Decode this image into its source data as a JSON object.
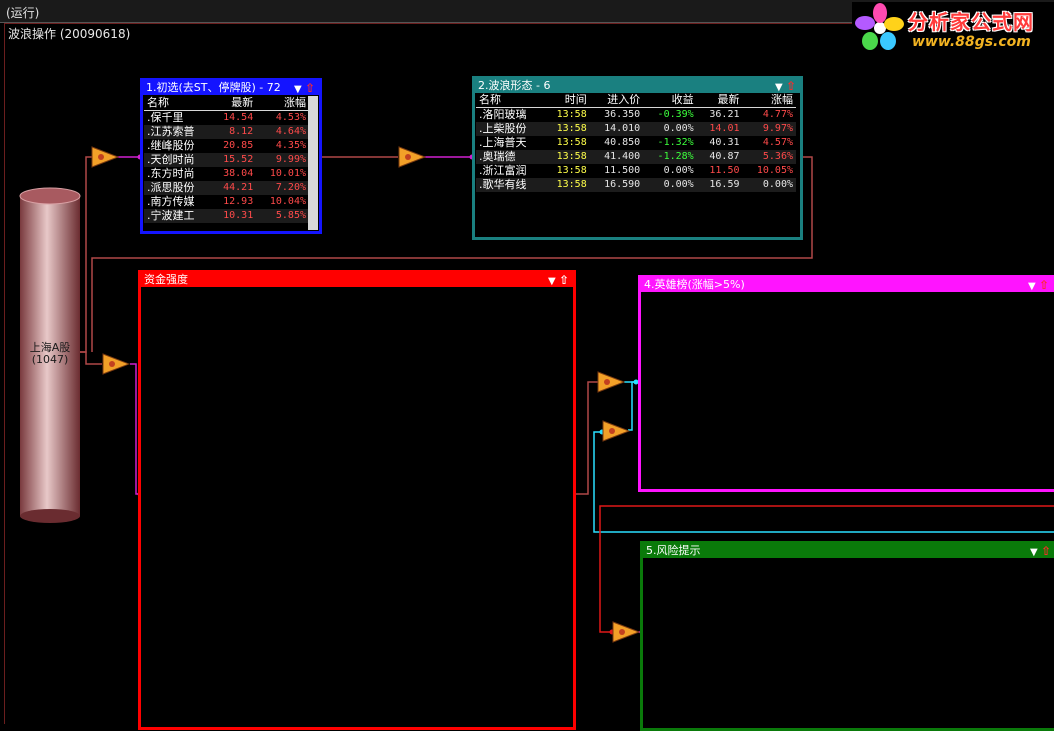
{
  "window": {
    "run_label": "(运行)",
    "strategy_title": "波浪操作 (20090618)"
  },
  "logo": {
    "name": "分析家公式网",
    "url_text": "www.88gs.com"
  },
  "source": {
    "label": "上海A股",
    "count": "(1047)"
  },
  "node_icon": "trigger-node-icon",
  "panel1": {
    "title": "1.初选(去ST、停牌股) - 72",
    "columns": [
      "名称",
      "最新",
      "涨幅"
    ],
    "rows": [
      {
        "name": "保千里",
        "last": "14.54",
        "chg": "4.53%"
      },
      {
        "name": "江苏索普",
        "last": "8.12",
        "chg": "4.64%"
      },
      {
        "name": "继峰股份",
        "last": "20.85",
        "chg": "4.35%"
      },
      {
        "name": "天创时尚",
        "last": "15.52",
        "chg": "9.99%"
      },
      {
        "name": "东方时尚",
        "last": "38.04",
        "chg": "10.01%"
      },
      {
        "name": "派思股份",
        "last": "44.21",
        "chg": "7.20%"
      },
      {
        "name": "南方传媒",
        "last": "12.93",
        "chg": "10.04%"
      },
      {
        "name": "宁波建工",
        "last": "10.31",
        "chg": "5.85%"
      }
    ]
  },
  "panel2": {
    "title": "2.波浪形态 - 6",
    "columns": [
      "名称",
      "时间",
      "进入价",
      "收益",
      "最新",
      "涨幅"
    ],
    "rows": [
      {
        "name": "洛阳玻璃",
        "time": "13:58",
        "entry": "36.350",
        "gain": "-0.39%",
        "last": "36.21",
        "chg": "4.77%"
      },
      {
        "name": "上柴股份",
        "time": "13:58",
        "entry": "14.010",
        "gain": "0.00%",
        "last": "14.01",
        "chg": "9.97%"
      },
      {
        "name": "上海普天",
        "time": "13:58",
        "entry": "40.850",
        "gain": "-1.32%",
        "last": "40.31",
        "chg": "4.57%"
      },
      {
        "name": "奥瑞德",
        "time": "13:58",
        "entry": "41.400",
        "gain": "-1.28%",
        "last": "40.87",
        "chg": "5.36%"
      },
      {
        "name": "浙江富润",
        "time": "13:58",
        "entry": "11.500",
        "gain": "0.00%",
        "last": "11.50",
        "chg": "10.05%"
      },
      {
        "name": "歌华有线",
        "time": "13:58",
        "entry": "16.590",
        "gain": "0.00%",
        "last": "16.59",
        "chg": "0.00%"
      }
    ]
  },
  "panel3": {
    "title": "资金强度"
  },
  "panel4": {
    "title": "4.英雄榜(涨幅>5%)"
  },
  "panel5": {
    "title": "5.风险提示"
  },
  "colors": {
    "panel1": "#1414ff",
    "panel2": "#1a8080",
    "panel3": "#ff0000",
    "panel4": "#ff14ff",
    "panel5": "#0a7a0a",
    "up": "#ff4a4a",
    "down": "#3cff3c",
    "time": "#ffff4a"
  }
}
